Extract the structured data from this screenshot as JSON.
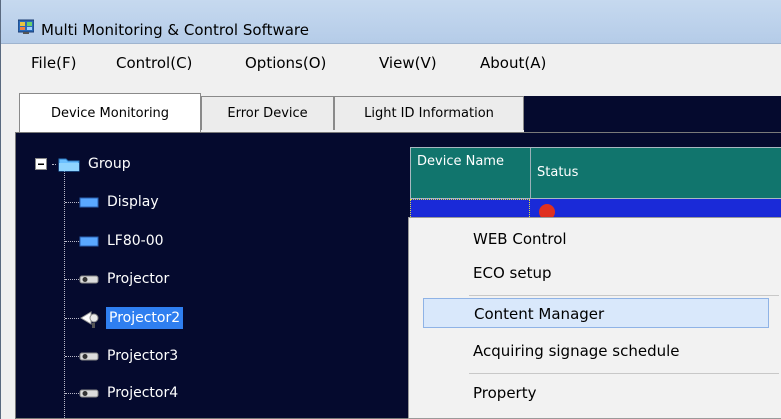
{
  "window": {
    "title": "Multi Monitoring & Control Software",
    "icon": "app-monitor-icon"
  },
  "menu": [
    "File(F)",
    "Control(C)",
    "Options(O)",
    "View(V)",
    "About(A)"
  ],
  "tabs": [
    {
      "label": "Device Monitoring",
      "active": true
    },
    {
      "label": "Error Device",
      "active": false
    },
    {
      "label": "Light ID Information",
      "active": false
    }
  ],
  "tree": {
    "root": {
      "label": "Group",
      "icon": "folder-icon",
      "expander": "minus-box-icon"
    },
    "items": [
      {
        "label": "Display",
        "icon": "display-icon",
        "selected": false
      },
      {
        "label": "LF80-00",
        "icon": "display-icon",
        "selected": false
      },
      {
        "label": "Projector",
        "icon": "projector-icon",
        "selected": false
      },
      {
        "label": "Projector2",
        "icon": "projector-warning-icon",
        "selected": true
      },
      {
        "label": "Projector3",
        "icon": "projector-icon",
        "selected": false
      },
      {
        "label": "Projector4",
        "icon": "projector-icon",
        "selected": false
      }
    ]
  },
  "table": {
    "headers": [
      "Device Name",
      "Status"
    ]
  },
  "context_menu": {
    "items": [
      "WEB Control",
      "ECO setup",
      "Content Manager",
      "Acquiring signage schedule",
      "Property"
    ],
    "highlighted": "Content Manager"
  },
  "colors": {
    "panel_bg": "#050a2e",
    "selection": "#2f7ff0",
    "header_teal": "#11756d",
    "menu_highlight": "#d9e8fb"
  }
}
